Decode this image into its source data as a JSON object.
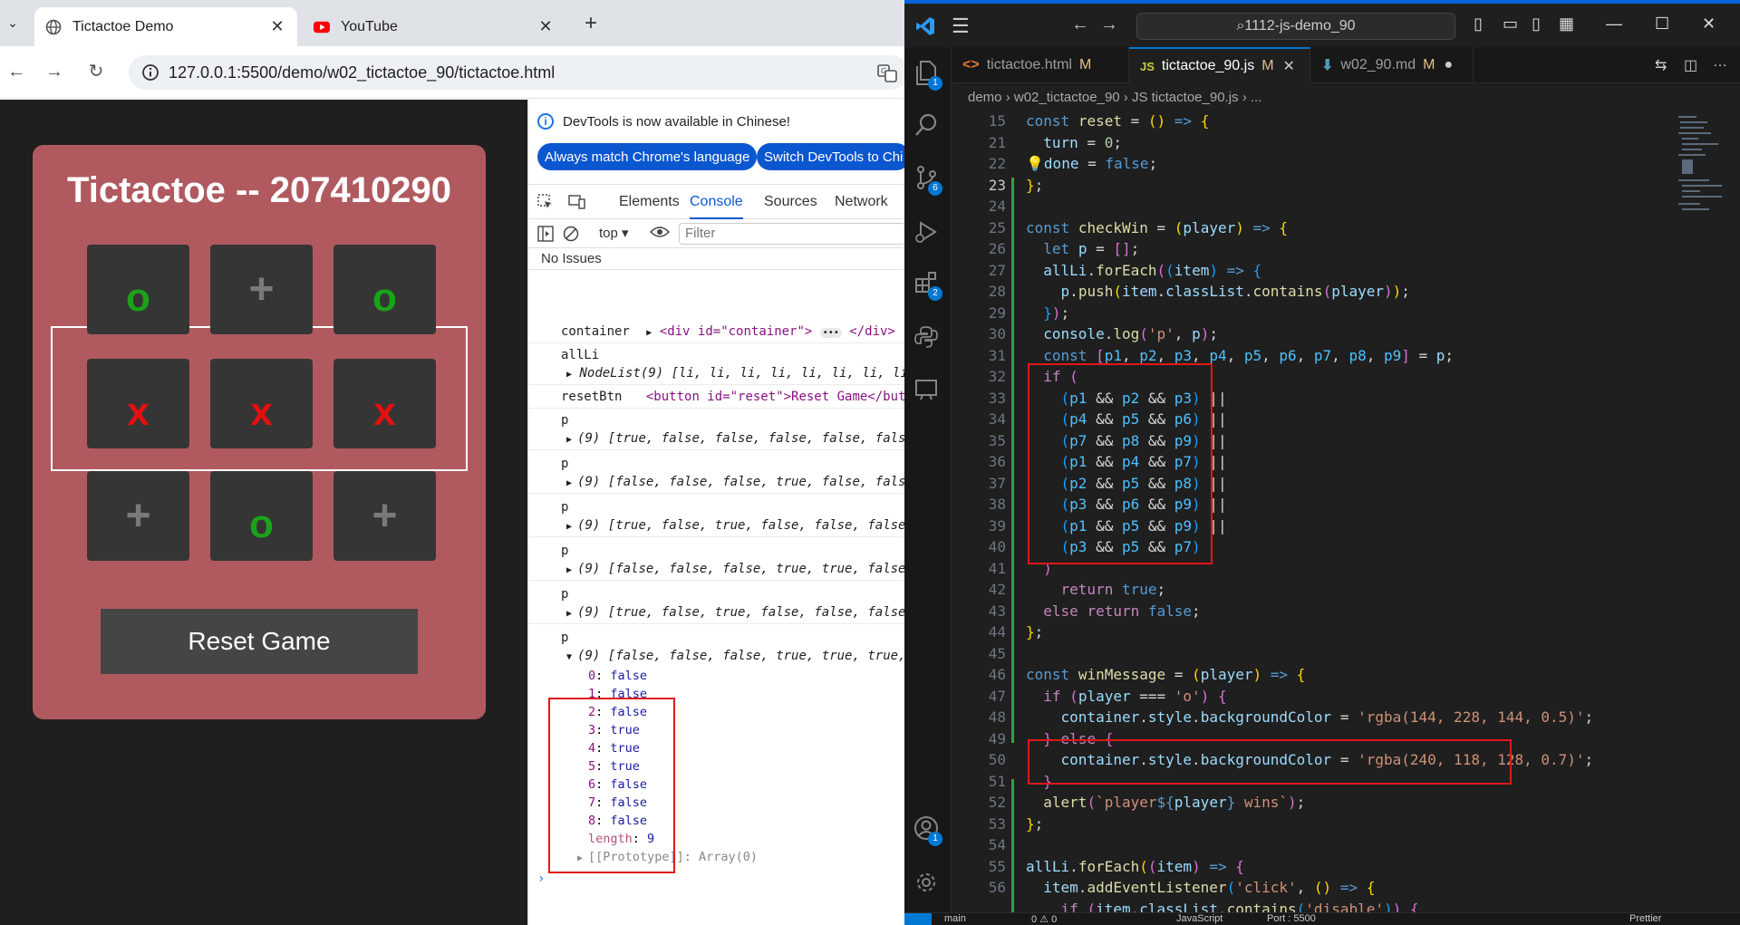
{
  "browser": {
    "tabs": [
      {
        "title": "Tictactoe Demo",
        "close": "✕"
      },
      {
        "title": "YouTube",
        "close": "✕"
      }
    ],
    "new_tab": "+",
    "url": "127.0.0.1:5500/demo/w02_tictactoe_90/tictactoe.html"
  },
  "game": {
    "title": "Tictactoe -- 207410290",
    "cells": [
      "o",
      "+",
      "o",
      "x",
      "x",
      "x",
      "+",
      "o",
      "+"
    ],
    "reset_label": "Reset Game"
  },
  "devtools": {
    "info_message": "DevTools is now available in Chinese!",
    "btn_match": "Always match Chrome's language",
    "btn_switch": "Switch DevTools to Chi",
    "tabs": [
      "Elements",
      "Console",
      "Sources",
      "Network"
    ],
    "context": "top",
    "filter_placeholder": "Filter",
    "issues": "No Issues",
    "logs": {
      "container_label": "container",
      "container_open": "<div id=\"container\">",
      "container_close": "</div>",
      "allli_label": "allLi",
      "nodelist": "NodeList(9) [li, li, li, li, li, li, li, li,",
      "resetbtn_label": "resetBtn",
      "resetbtn_html": "<button id=\"reset\">Reset Game</butt",
      "p_label": "p",
      "arrays": [
        "(9) [true, false, false, false, false, false",
        "(9) [false, false, false, true, false, false",
        "(9) [true, false, true, false, false, false,",
        "(9) [false, false, false, true, true, false,",
        "(9) [true, false, true, false, false, false,",
        "(9) [false, false, false, true, true, true,"
      ],
      "expanded": [
        {
          "k": "0",
          "v": "false"
        },
        {
          "k": "1",
          "v": "false"
        },
        {
          "k": "2",
          "v": "false"
        },
        {
          "k": "3",
          "v": "true"
        },
        {
          "k": "4",
          "v": "true"
        },
        {
          "k": "5",
          "v": "true"
        },
        {
          "k": "6",
          "v": "false"
        },
        {
          "k": "7",
          "v": "false"
        },
        {
          "k": "8",
          "v": "false"
        }
      ],
      "length_label": "length",
      "length_value": "9",
      "prototype": "[[Prototype]]: Array(0)"
    }
  },
  "vscode": {
    "search": "1112-js-demo_90",
    "tabs": [
      {
        "icon": "<>",
        "name": "tictactoe.html",
        "status": "M"
      },
      {
        "icon": "JS",
        "name": "tictactoe_90.js",
        "status": "M"
      },
      {
        "icon": "⬇",
        "name": "w02_90.md",
        "status": "M"
      }
    ],
    "breadcrumb": [
      "demo",
      "w02_tictactoe_90",
      "JS tictactoe_90.js",
      "..."
    ],
    "badges": {
      "explorer": "1",
      "scm": "6",
      "extensions": "2",
      "accounts": "1"
    },
    "line_numbers": [
      "15",
      "21",
      "22",
      "23",
      "24",
      "25",
      "26",
      "27",
      "28",
      "29",
      "30",
      "31",
      "32",
      "33",
      "34",
      "35",
      "36",
      "37",
      "38",
      "39",
      "40",
      "41",
      "42",
      "43",
      "44",
      "45",
      "46",
      "47",
      "48",
      "49",
      "50",
      "51",
      "52",
      "53",
      "54",
      "55",
      "56"
    ],
    "status_items": [
      "main",
      "0 ⚠ 0",
      "JavaScript",
      "Port : 5500",
      "Prettier"
    ]
  }
}
